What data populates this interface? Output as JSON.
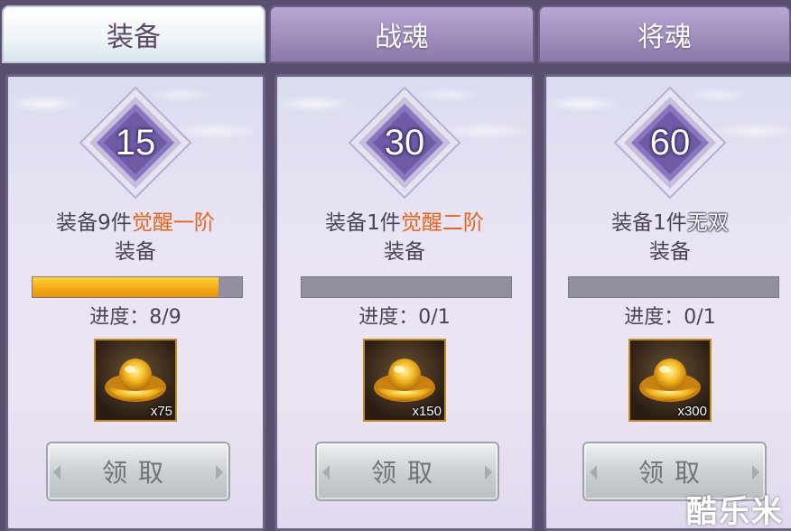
{
  "tabs": [
    {
      "label": "装备",
      "active": true
    },
    {
      "label": "战魂",
      "active": false
    },
    {
      "label": "将魂",
      "active": false
    }
  ],
  "cards": [
    {
      "level": "15",
      "desc_prefix": "装备9件",
      "desc_highlight": "觉醒一阶",
      "desc_line2": "装备",
      "progress_fraction": 0.889,
      "progress_text": "进度：8/9",
      "reward_count": "x75",
      "reward_icon": "gold-ingot-icon",
      "claim_label": "领取"
    },
    {
      "level": "30",
      "desc_prefix": "装备1件",
      "desc_highlight": "觉醒二阶",
      "desc_line2": "装备",
      "progress_fraction": 0,
      "progress_text": "进度：0/1",
      "reward_count": "x150",
      "reward_icon": "gold-ingot-icon",
      "claim_label": "领取"
    },
    {
      "level": "60",
      "desc_prefix": "装备1件",
      "desc_highlight": "无双",
      "desc_line2": "装备",
      "progress_fraction": 0,
      "progress_text": "进度：0/1",
      "reward_count": "x300",
      "reward_icon": "gold-ingot-icon",
      "claim_label": "领取"
    }
  ],
  "watermark": "酷乐米",
  "colors": {
    "highlight_orange": "#e5651c",
    "progress_fill": "#f4a814",
    "badge_purple": "#7a66ad"
  }
}
